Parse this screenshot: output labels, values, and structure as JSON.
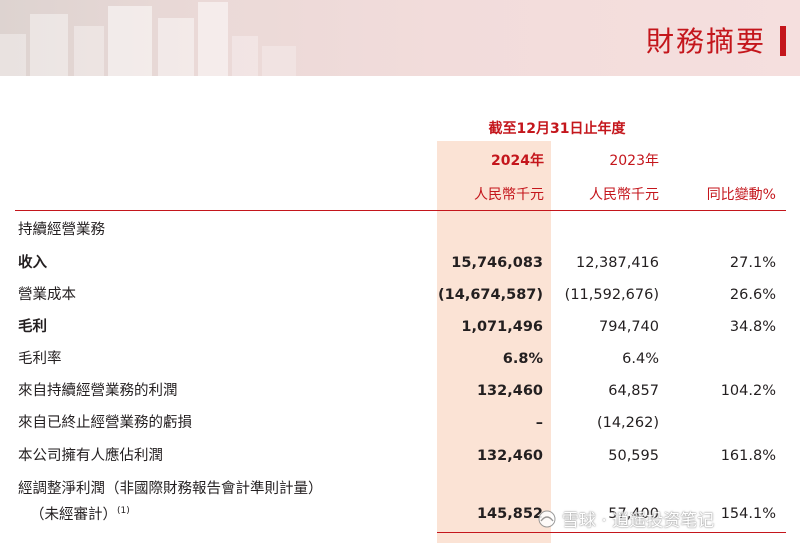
{
  "header": {
    "title": "財務摘要"
  },
  "table": {
    "period": "截至12月31日止年度",
    "col_2024_year": "2024年",
    "col_2023_year": "2023年",
    "col_2024_unit": "人民幣千元",
    "col_2023_unit": "人民幣千元",
    "col_change": "同比變動%",
    "rows": [
      {
        "label": "持續經營業務",
        "v2024": "",
        "v2023": "",
        "change": ""
      },
      {
        "label": "收入",
        "v2024": "15,746,083",
        "v2023": "12,387,416",
        "change": "27.1%"
      },
      {
        "label": "營業成本",
        "v2024": "(14,674,587)",
        "v2023": "(11,592,676)",
        "change": "26.6%"
      },
      {
        "label": "毛利",
        "v2024": "1,071,496",
        "v2023": "794,740",
        "change": "34.8%"
      },
      {
        "label": "毛利率",
        "v2024": "6.8%",
        "v2023": "6.4%",
        "change": ""
      },
      {
        "label": "來自持續經營業務的利潤",
        "v2024": "132,460",
        "v2023": "64,857",
        "change": "104.2%"
      },
      {
        "label": "來自已終止經營業務的虧損",
        "v2024": "–",
        "v2023": "(14,262)",
        "change": ""
      },
      {
        "label": "本公司擁有人應佔利潤",
        "v2024": "132,460",
        "v2023": "50,595",
        "change": "161.8%"
      },
      {
        "label": "經調整淨利潤（非國際財務報告會計準則計量）",
        "label2": "（未經審計）",
        "note": "(1)",
        "v2024": "145,852",
        "v2023": "57,400",
        "change": "154.1%"
      }
    ]
  },
  "watermark": {
    "text": "雪球 · 逍遥投资笔记"
  }
}
